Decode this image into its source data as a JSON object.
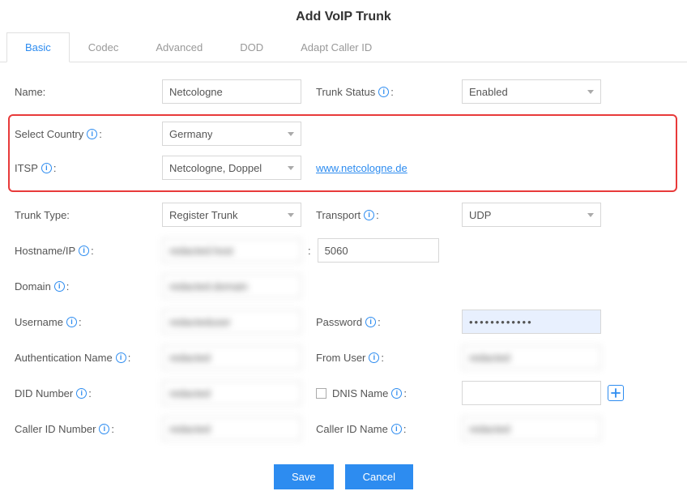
{
  "header": {
    "title": "Add VoIP Trunk"
  },
  "tabs": [
    {
      "label": "Basic",
      "active": true
    },
    {
      "label": "Codec"
    },
    {
      "label": "Advanced"
    },
    {
      "label": "DOD"
    },
    {
      "label": "Adapt Caller ID"
    }
  ],
  "fields": {
    "name": {
      "label": "Name:",
      "value": "Netcologne"
    },
    "trunk_status": {
      "label": "Trunk Status",
      "value": "Enabled"
    },
    "select_country": {
      "label": "Select Country",
      "value": "Germany"
    },
    "itsp": {
      "label": "ITSP",
      "value": "Netcologne, Doppel",
      "link": "www.netcologne.de"
    },
    "trunk_type": {
      "label": "Trunk Type:",
      "value": "Register Trunk"
    },
    "transport": {
      "label": "Transport",
      "value": "UDP"
    },
    "hostname": {
      "label": "Hostname/IP",
      "value": "redacted.host"
    },
    "port": {
      "value": "5060"
    },
    "domain": {
      "label": "Domain",
      "value": "redacted.domain"
    },
    "username": {
      "label": "Username",
      "value": "redacteduser"
    },
    "password": {
      "label": "Password",
      "value": "••••••••••••"
    },
    "auth_name": {
      "label": "Authentication Name",
      "value": "redacted"
    },
    "from_user": {
      "label": "From User",
      "value": "redacted"
    },
    "did_number": {
      "label": "DID Number",
      "value": "redacted"
    },
    "dnis_name": {
      "label": "DNIS Name",
      "value": ""
    },
    "caller_id_number": {
      "label": "Caller ID Number",
      "value": "redacted"
    },
    "caller_id_name": {
      "label": "Caller ID Name",
      "value": "redacted"
    }
  },
  "buttons": {
    "save": "Save",
    "cancel": "Cancel"
  }
}
